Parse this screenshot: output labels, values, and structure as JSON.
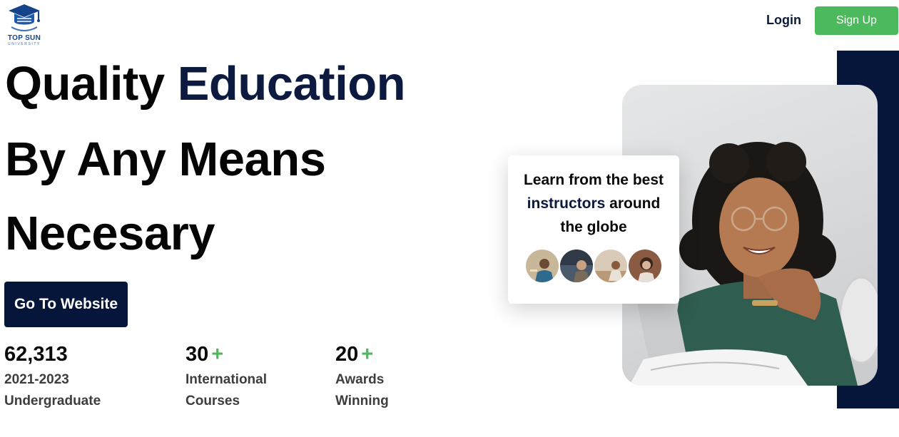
{
  "header": {
    "logo": {
      "name": "Top Sun University logo",
      "icon": "graduation-cap-icon",
      "title": "TOP SUN",
      "subtitle": "UNIVERSITY"
    },
    "login_label": "Login",
    "signup_label": "Sign Up"
  },
  "hero": {
    "line1_plain": "Quality ",
    "line1_accent": "Education",
    "line2": "By Any Means",
    "line3": "Necesary",
    "cta_label": "Go To Website"
  },
  "stats": [
    {
      "value": "62,313",
      "plus": "",
      "label_line1": "2021-2023",
      "label_line2": "Undergraduate"
    },
    {
      "value": "30",
      "plus": "+",
      "label_line1": "International",
      "label_line2": "Courses"
    },
    {
      "value": "20",
      "plus": "+",
      "label_line1": "Awards",
      "label_line2": "Winning"
    }
  ],
  "card": {
    "line1": "Learn from the best",
    "line2_accent": "instructors",
    "line2_plain": " around",
    "line3": "the globe",
    "avatars": [
      "instructor-avatar-1",
      "instructor-avatar-2",
      "instructor-avatar-3",
      "instructor-avatar-4"
    ]
  },
  "colors": {
    "navy": "#06163b",
    "accent_text": "#0b1a3e",
    "green": "#4cba5c",
    "logo_blue": "#14438c"
  }
}
